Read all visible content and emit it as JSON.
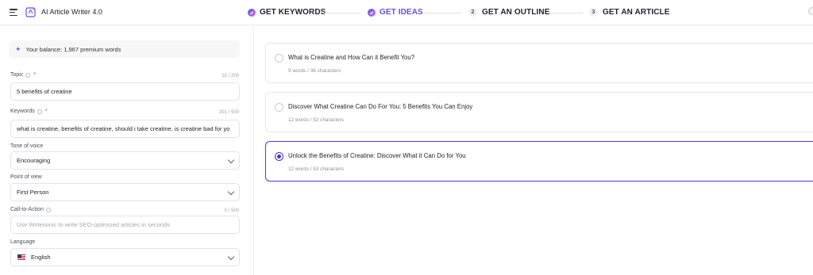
{
  "header": {
    "app_title": "AI Article Writer 4.0",
    "steps": [
      {
        "number": "",
        "label": "GET KEYWORDS",
        "state": "done"
      },
      {
        "number": "",
        "label": "GET IDEAS",
        "state": "active"
      },
      {
        "number": "2",
        "label": "GET AN OUTLINE",
        "state": "pending"
      },
      {
        "number": "3",
        "label": "GET AN ARTICLE",
        "state": "pending"
      }
    ],
    "accent_color": "#6b4ce6"
  },
  "sidebar": {
    "balance_text": "Your balance: 1,967 premium words",
    "topic": {
      "label": "Topic",
      "required": "*",
      "counter": "22 / 200",
      "value": "5 benefits of creatine"
    },
    "keywords": {
      "label": "Keywords",
      "required": "*",
      "counter": "201 / 500",
      "value": "what is creatine, benefits of creatine, should i take creatine, is creatine bad for yo"
    },
    "tone": {
      "label": "Tone of voice",
      "value": "Encouraging"
    },
    "point_of_view": {
      "label": "Point of view",
      "value": "First Person"
    },
    "cta": {
      "label": "Call-to-Action",
      "counter": "0 / 500",
      "placeholder": "Use Writesonic to write SEO-optimized articles in seconds"
    },
    "language": {
      "label": "Language",
      "value": "English"
    }
  },
  "ideas": [
    {
      "title": "What is Creatine and How Can it Benefit You?",
      "meta": "9 words / 36 characters",
      "selected": false
    },
    {
      "title": "Discover What Creatine Can Do For You: 5 Benefits You Can Enjoy",
      "meta": "12 words / 52 characters",
      "selected": false
    },
    {
      "title": "Unlock the Benefits of Creatine: Discover What it Can Do for You",
      "meta": "12 words / 53 characters",
      "selected": true
    }
  ]
}
